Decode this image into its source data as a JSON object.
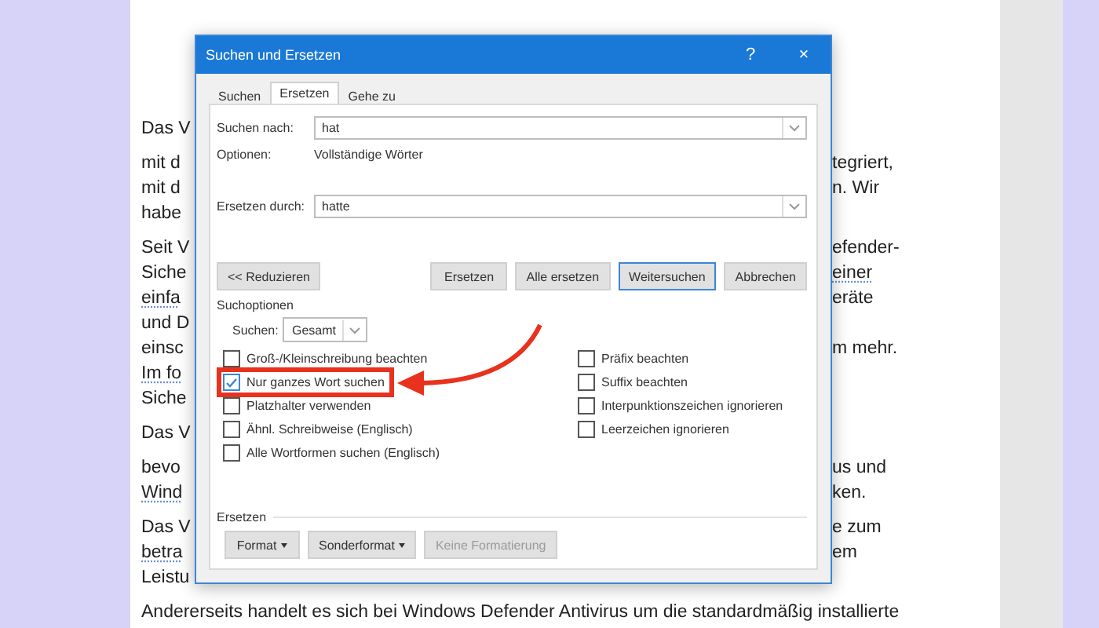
{
  "document": {
    "paragraphs": [
      {
        "lines": [
          {
            "left": {
              "text": "Das V",
              "underlined": false
            }
          }
        ]
      },
      {
        "lines": [
          {
            "left": {
              "text": "mit d",
              "underlined": false
            },
            "right": {
              "text": "tegriert,",
              "underlined": false
            }
          },
          {
            "left": {
              "text": "mit d",
              "underlined": false
            },
            "right": {
              "text": "n. Wir",
              "underlined": false
            }
          },
          {
            "left": {
              "text": "habe",
              "underlined": false
            }
          }
        ]
      },
      {
        "lines": [
          {
            "left": {
              "text": "Seit V",
              "underlined": false
            },
            "right": {
              "text": "efender-",
              "underlined": false
            }
          },
          {
            "left": {
              "text": "Siche",
              "underlined": false
            },
            "right": {
              "text": "einer",
              "underlined": true
            }
          },
          {
            "left": {
              "text": "einfa",
              "underlined": true
            },
            "right": {
              "text": "eräte",
              "underlined": false
            }
          },
          {
            "left": {
              "text": "und D",
              "underlined": false
            }
          },
          {
            "left": {
              "text": "einsc",
              "underlined": false
            },
            "right": {
              "text": "m mehr.",
              "underlined": false
            }
          },
          {
            "left": {
              "text": "Im fo",
              "underlined": true
            }
          },
          {
            "left": {
              "text": "Siche",
              "underlined": false
            }
          }
        ]
      },
      {
        "lines": [
          {
            "left": {
              "text": "Das V",
              "underlined": false
            }
          }
        ]
      },
      {
        "lines": [
          {
            "left": {
              "text": "bevo",
              "underlined": false
            },
            "right": {
              "text": "us und",
              "underlined": false
            }
          },
          {
            "left": {
              "text": "Wind",
              "underlined": true
            },
            "right": {
              "text": "ken.",
              "underlined": false
            }
          }
        ]
      },
      {
        "lines": [
          {
            "left": {
              "text": "Das V",
              "underlined": false
            },
            "right": {
              "text": "e zum",
              "underlined": false
            }
          },
          {
            "left": {
              "text": "betra",
              "underlined": true
            },
            "right": {
              "text": "em",
              "underlined": false
            }
          },
          {
            "left": {
              "text": "Leistu",
              "underlined": false
            }
          }
        ]
      },
      {
        "lines": [
          {
            "full": {
              "text": "Andererseits handelt es sich bei Windows Defender Antivirus um die standardmäßig installierte",
              "underlined": false
            }
          }
        ]
      }
    ]
  },
  "dialog": {
    "title": "Suchen und Ersetzen",
    "help": "?",
    "close": "×",
    "tabs": [
      {
        "label": "Suchen",
        "selected": false
      },
      {
        "label": "Ersetzen",
        "selected": true
      },
      {
        "label": "Gehe zu",
        "selected": false
      }
    ],
    "find": {
      "label": "Suchen nach:",
      "value": "hat"
    },
    "options": {
      "label": "Optionen:",
      "value": "Vollständige Wörter"
    },
    "replace": {
      "label": "Ersetzen durch:",
      "value": "hatte"
    },
    "buttons": [
      {
        "label": "<< Reduzieren",
        "kind": "left",
        "default": false
      },
      {
        "label": "Ersetzen",
        "kind": "right",
        "default": false
      },
      {
        "label": "Alle ersetzen",
        "kind": "right",
        "default": false
      },
      {
        "label": "Weitersuchen",
        "kind": "right",
        "default": true
      },
      {
        "label": "Abbrechen",
        "kind": "right",
        "default": false
      }
    ],
    "search_options": {
      "heading": "Suchoptionen",
      "direction_label": "Suchen:",
      "direction_value": "Gesamt",
      "left": [
        {
          "label": "Groß-/Kleinschreibung beachten",
          "checked": false,
          "highlighted": false
        },
        {
          "label": "Nur ganzes Wort suchen",
          "checked": true,
          "highlighted": true
        },
        {
          "label": "Platzhalter verwenden",
          "checked": false,
          "highlighted": false
        },
        {
          "label": "Ähnl. Schreibweise (Englisch)",
          "checked": false,
          "highlighted": false
        },
        {
          "label": "Alle Wortformen suchen (Englisch)",
          "checked": false,
          "highlighted": false
        }
      ],
      "right": [
        {
          "label": "Präfix beachten",
          "checked": false
        },
        {
          "label": "Suffix beachten",
          "checked": false
        },
        {
          "label": "Interpunktionszeichen ignorieren",
          "checked": false
        },
        {
          "label": "Leerzeichen ignorieren",
          "checked": false
        }
      ]
    },
    "replace_section": {
      "heading": "Ersetzen",
      "buttons": [
        {
          "label": "Format",
          "dropdown": true,
          "disabled": false
        },
        {
          "label": "Sonderformat",
          "dropdown": true,
          "disabled": false
        },
        {
          "label": "Keine Formatierung",
          "dropdown": false,
          "disabled": true
        }
      ]
    }
  }
}
